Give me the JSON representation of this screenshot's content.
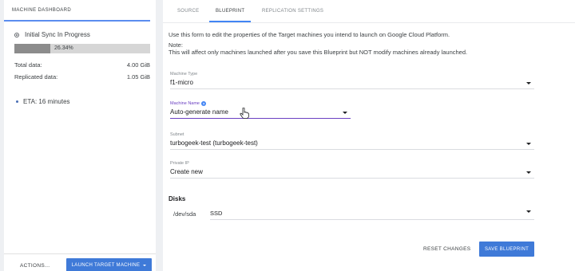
{
  "left_panel": {
    "tab_label": "MACHINE DASHBOARD",
    "sync_status": "Initial Sync In Progress",
    "progress": {
      "label": "26.34%",
      "fraction": 0.2634
    },
    "stats": [
      {
        "label": "Total data:",
        "value": "4.00 GiB"
      },
      {
        "label": "Replicated data:",
        "value": "1.05 GiB"
      }
    ],
    "eta": "ETA:  16 minutes",
    "actions_label": "ACTIONS...",
    "launch_label": "LAUNCH TARGET MACHINE"
  },
  "tabs": [
    {
      "label": "SOURCE",
      "active": false
    },
    {
      "label": "BLUEPRINT",
      "active": true
    },
    {
      "label": "REPLICATION SETTINGS",
      "active": false
    }
  ],
  "form": {
    "intro": "Use this form to edit the properties of the Target machines you intend to launch on Google Cloud Platform.",
    "note_label": "Note:",
    "note_text": "This will affect only machines launched after you save this Blueprint but NOT modify machines already launched.",
    "machine_type": {
      "label": "Machine Type",
      "value": "f1-micro"
    },
    "machine_name": {
      "label": "Machine Name",
      "value": "Auto-generate name",
      "help_icon": "?"
    },
    "subnet": {
      "label": "Subnet",
      "value": "turbogeek-test (turbogeek-test)"
    },
    "private_ip": {
      "label": "Private IP",
      "value": "Create new"
    },
    "disks_heading": "Disks",
    "disk": {
      "device": "/dev/sda",
      "type": "SSD"
    }
  },
  "buttons": {
    "reset": "RESET CHANGES",
    "save": "SAVE BLUEPRINT"
  },
  "colors": {
    "accent": "#3f7ad8",
    "tab_underline": "#4285f4",
    "focus": "#6a3fc2"
  },
  "icons": [
    "radio-icon",
    "bullet-icon",
    "caret-icon",
    "help-icon",
    "dropdown-arrow-icon",
    "hand-pointer-icon"
  ]
}
